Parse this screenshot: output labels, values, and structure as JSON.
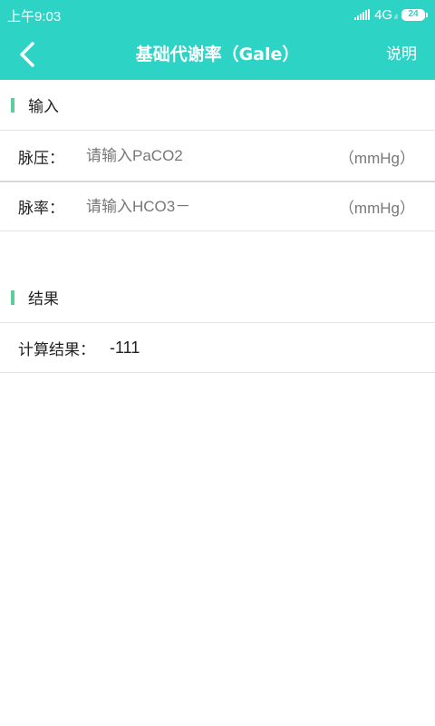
{
  "status_bar": {
    "time": "上午9:03",
    "network": "4G",
    "network_sub": "ıl",
    "battery": "24"
  },
  "header": {
    "title": "基础代谢率（Gale）",
    "help_label": "说明"
  },
  "input_section": {
    "title": "输入",
    "fields": [
      {
        "label": "脉压：",
        "placeholder": "请输入PaCO2",
        "value": "",
        "unit": "（mmHg）"
      },
      {
        "label": "脉率：",
        "placeholder": "请输入HCO3－",
        "value": "",
        "unit": "（mmHg）"
      }
    ]
  },
  "result_section": {
    "title": "结果",
    "label": "计算结果：",
    "value": "-111"
  },
  "colors": {
    "primary": "#2dd4c6",
    "section_marker": "#5ccd9c",
    "divider": "#e4e4e4"
  },
  "icons": {
    "back": "chevron-left-icon",
    "signal": "signal-icon",
    "battery": "battery-icon"
  }
}
